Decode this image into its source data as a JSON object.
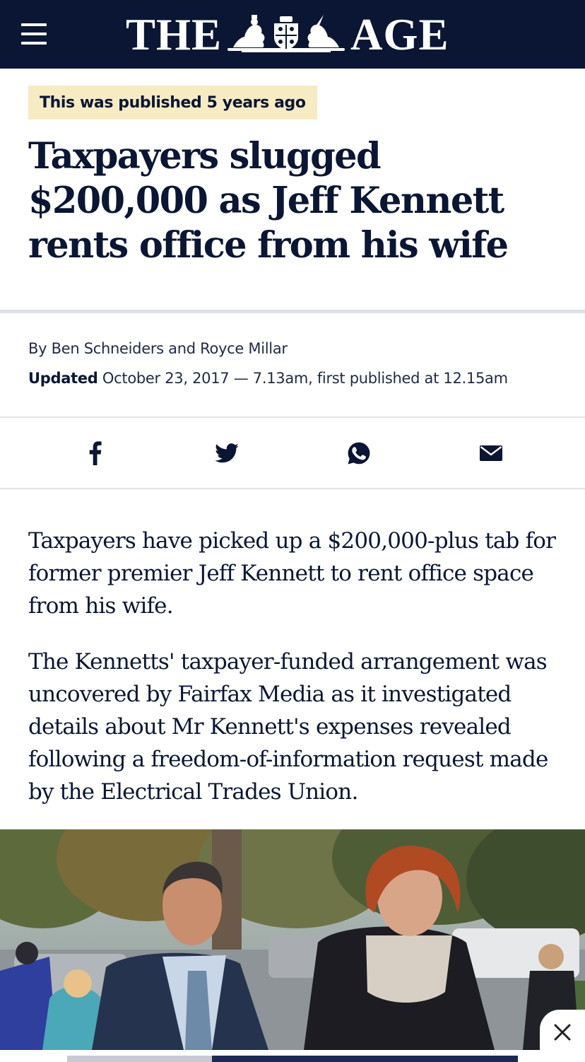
{
  "header": {
    "brand_left": "THE",
    "brand_right": "AGE",
    "menu_icon": "hamburger-icon",
    "background": "#0a1633"
  },
  "notice": {
    "text": "This was published 5 years ago",
    "background": "#f7ebc4"
  },
  "article": {
    "headline": "Taxpayers slugged $200,000 as Jeff Kennett rents office from his wife",
    "byline": "By Ben Schneiders and Royce Millar",
    "updated_label": "Updated",
    "updated_text": "October 23, 2017 — 7.13am, first published at 12.15am",
    "paragraphs": [
      "Taxpayers have picked up a $200,000-plus tab for former premier Jeff Kennett to rent office space from his wife.",
      "The Kennetts' taxpayer-funded arrangement was uncovered by Fairfax Media as it investigated details about Mr Kennett's expenses revealed following a freedom-of-information request made by the Electrical Trades Union."
    ]
  },
  "share": {
    "icons": [
      "facebook-icon",
      "twitter-icon",
      "whatsapp-icon",
      "email-icon"
    ]
  },
  "photo": {
    "close_icon": "close-icon"
  }
}
